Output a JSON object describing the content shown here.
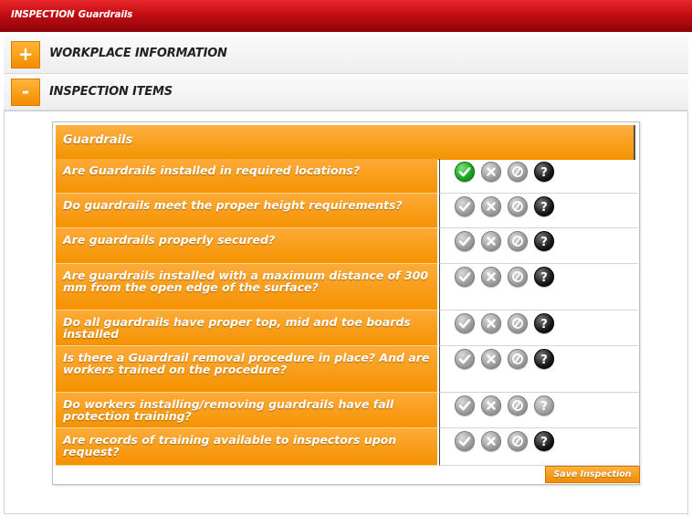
{
  "title": {
    "main": "INSPECTION",
    "sub": "Guardrails"
  },
  "sections": [
    {
      "toggle": "+",
      "label": "WORKPLACE INFORMATION"
    },
    {
      "toggle": "-",
      "label": "INSPECTION ITEMS"
    }
  ],
  "group": {
    "header": "Guardrails"
  },
  "answer_icons": [
    "check-icon",
    "x-icon",
    "na-icon",
    "question-icon"
  ],
  "colors": {
    "accent": "#f59200",
    "titlebar": "#c40d13",
    "selected_check": "#17a41d"
  },
  "questions": [
    {
      "text": "Are Guardrails installed in required locations?",
      "selected": "yes"
    },
    {
      "text": "Do guardrails meet the proper height requirements?",
      "selected": null
    },
    {
      "text": "Are guardrails properly secured?",
      "selected": null
    },
    {
      "text": "Are guardrails installed with a maximum distance of 300 mm from the open edge of the surface?",
      "selected": null
    },
    {
      "text": "Do all guardrails have proper top, mid and toe boards installed",
      "selected": null
    },
    {
      "text": "Is there a Guardrail removal procedure in place? And are workers trained on the procedure?",
      "selected": null
    },
    {
      "text": "Do workers installing/removing guardrails have fall protection training?",
      "selected": null
    },
    {
      "text": "Are records of training available to inspectors upon request?",
      "selected": null
    }
  ],
  "save_label": "Save Inspection"
}
